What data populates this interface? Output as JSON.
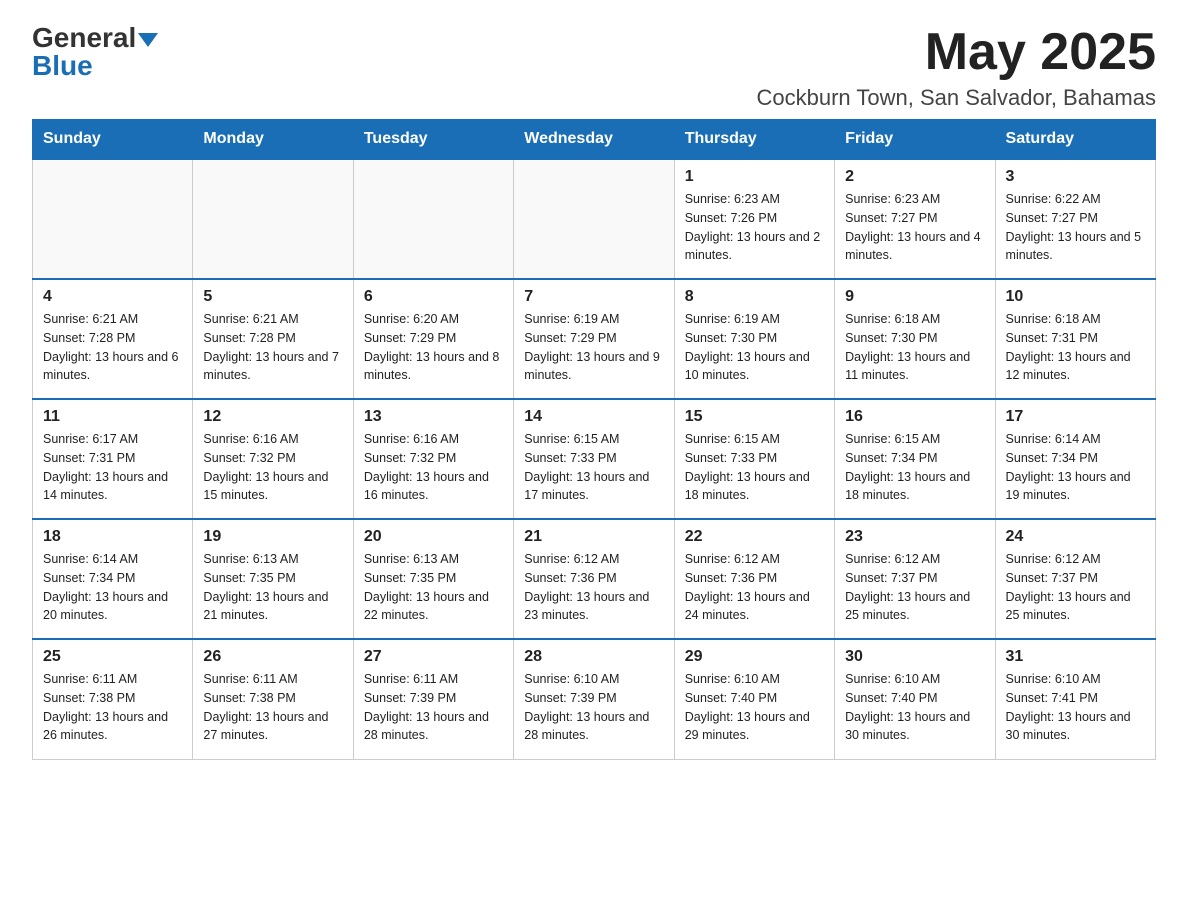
{
  "header": {
    "logo_line1": "General",
    "logo_line2": "Blue",
    "month": "May 2025",
    "location": "Cockburn Town, San Salvador, Bahamas"
  },
  "days_of_week": [
    "Sunday",
    "Monday",
    "Tuesday",
    "Wednesday",
    "Thursday",
    "Friday",
    "Saturday"
  ],
  "weeks": [
    [
      {
        "day": "",
        "info": ""
      },
      {
        "day": "",
        "info": ""
      },
      {
        "day": "",
        "info": ""
      },
      {
        "day": "",
        "info": ""
      },
      {
        "day": "1",
        "info": "Sunrise: 6:23 AM\nSunset: 7:26 PM\nDaylight: 13 hours and 2 minutes."
      },
      {
        "day": "2",
        "info": "Sunrise: 6:23 AM\nSunset: 7:27 PM\nDaylight: 13 hours and 4 minutes."
      },
      {
        "day": "3",
        "info": "Sunrise: 6:22 AM\nSunset: 7:27 PM\nDaylight: 13 hours and 5 minutes."
      }
    ],
    [
      {
        "day": "4",
        "info": "Sunrise: 6:21 AM\nSunset: 7:28 PM\nDaylight: 13 hours and 6 minutes."
      },
      {
        "day": "5",
        "info": "Sunrise: 6:21 AM\nSunset: 7:28 PM\nDaylight: 13 hours and 7 minutes."
      },
      {
        "day": "6",
        "info": "Sunrise: 6:20 AM\nSunset: 7:29 PM\nDaylight: 13 hours and 8 minutes."
      },
      {
        "day": "7",
        "info": "Sunrise: 6:19 AM\nSunset: 7:29 PM\nDaylight: 13 hours and 9 minutes."
      },
      {
        "day": "8",
        "info": "Sunrise: 6:19 AM\nSunset: 7:30 PM\nDaylight: 13 hours and 10 minutes."
      },
      {
        "day": "9",
        "info": "Sunrise: 6:18 AM\nSunset: 7:30 PM\nDaylight: 13 hours and 11 minutes."
      },
      {
        "day": "10",
        "info": "Sunrise: 6:18 AM\nSunset: 7:31 PM\nDaylight: 13 hours and 12 minutes."
      }
    ],
    [
      {
        "day": "11",
        "info": "Sunrise: 6:17 AM\nSunset: 7:31 PM\nDaylight: 13 hours and 14 minutes."
      },
      {
        "day": "12",
        "info": "Sunrise: 6:16 AM\nSunset: 7:32 PM\nDaylight: 13 hours and 15 minutes."
      },
      {
        "day": "13",
        "info": "Sunrise: 6:16 AM\nSunset: 7:32 PM\nDaylight: 13 hours and 16 minutes."
      },
      {
        "day": "14",
        "info": "Sunrise: 6:15 AM\nSunset: 7:33 PM\nDaylight: 13 hours and 17 minutes."
      },
      {
        "day": "15",
        "info": "Sunrise: 6:15 AM\nSunset: 7:33 PM\nDaylight: 13 hours and 18 minutes."
      },
      {
        "day": "16",
        "info": "Sunrise: 6:15 AM\nSunset: 7:34 PM\nDaylight: 13 hours and 18 minutes."
      },
      {
        "day": "17",
        "info": "Sunrise: 6:14 AM\nSunset: 7:34 PM\nDaylight: 13 hours and 19 minutes."
      }
    ],
    [
      {
        "day": "18",
        "info": "Sunrise: 6:14 AM\nSunset: 7:34 PM\nDaylight: 13 hours and 20 minutes."
      },
      {
        "day": "19",
        "info": "Sunrise: 6:13 AM\nSunset: 7:35 PM\nDaylight: 13 hours and 21 minutes."
      },
      {
        "day": "20",
        "info": "Sunrise: 6:13 AM\nSunset: 7:35 PM\nDaylight: 13 hours and 22 minutes."
      },
      {
        "day": "21",
        "info": "Sunrise: 6:12 AM\nSunset: 7:36 PM\nDaylight: 13 hours and 23 minutes."
      },
      {
        "day": "22",
        "info": "Sunrise: 6:12 AM\nSunset: 7:36 PM\nDaylight: 13 hours and 24 minutes."
      },
      {
        "day": "23",
        "info": "Sunrise: 6:12 AM\nSunset: 7:37 PM\nDaylight: 13 hours and 25 minutes."
      },
      {
        "day": "24",
        "info": "Sunrise: 6:12 AM\nSunset: 7:37 PM\nDaylight: 13 hours and 25 minutes."
      }
    ],
    [
      {
        "day": "25",
        "info": "Sunrise: 6:11 AM\nSunset: 7:38 PM\nDaylight: 13 hours and 26 minutes."
      },
      {
        "day": "26",
        "info": "Sunrise: 6:11 AM\nSunset: 7:38 PM\nDaylight: 13 hours and 27 minutes."
      },
      {
        "day": "27",
        "info": "Sunrise: 6:11 AM\nSunset: 7:39 PM\nDaylight: 13 hours and 28 minutes."
      },
      {
        "day": "28",
        "info": "Sunrise: 6:10 AM\nSunset: 7:39 PM\nDaylight: 13 hours and 28 minutes."
      },
      {
        "day": "29",
        "info": "Sunrise: 6:10 AM\nSunset: 7:40 PM\nDaylight: 13 hours and 29 minutes."
      },
      {
        "day": "30",
        "info": "Sunrise: 6:10 AM\nSunset: 7:40 PM\nDaylight: 13 hours and 30 minutes."
      },
      {
        "day": "31",
        "info": "Sunrise: 6:10 AM\nSunset: 7:41 PM\nDaylight: 13 hours and 30 minutes."
      }
    ]
  ]
}
